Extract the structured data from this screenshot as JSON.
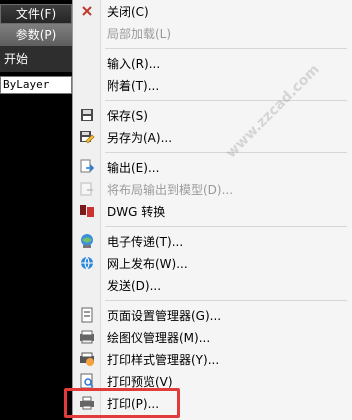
{
  "left": {
    "file_menu": "文件(F)",
    "params": "参数(P)",
    "start": "开始",
    "layer_combo": "ByLayer"
  },
  "menu": {
    "items": [
      {
        "label": "关闭(C)",
        "disabled": false,
        "icon": "close-x-icon"
      },
      {
        "label": "局部加载(L)",
        "disabled": true,
        "icon": ""
      },
      {
        "label": "输入(R)...",
        "disabled": false,
        "icon": ""
      },
      {
        "label": "附着(T)...",
        "disabled": false,
        "icon": ""
      },
      {
        "label": "保存(S)",
        "disabled": false,
        "icon": "save-icon"
      },
      {
        "label": "另存为(A)...",
        "disabled": false,
        "icon": "save-as-icon"
      },
      {
        "label": "输出(E)...",
        "disabled": false,
        "icon": "export-icon"
      },
      {
        "label": "将布局输出到模型(D)...",
        "disabled": true,
        "icon": ""
      },
      {
        "label": "DWG 转换",
        "disabled": false,
        "icon": "dwg-convert-icon"
      },
      {
        "label": "电子传递(T)...",
        "disabled": false,
        "icon": "etransmit-icon"
      },
      {
        "label": "网上发布(W)...",
        "disabled": false,
        "icon": "publish-web-icon"
      },
      {
        "label": "发送(D)...",
        "disabled": false,
        "icon": ""
      },
      {
        "label": "页面设置管理器(G)...",
        "disabled": false,
        "icon": "page-setup-icon"
      },
      {
        "label": "绘图仪管理器(M)...",
        "disabled": false,
        "icon": "plotter-manager-icon"
      },
      {
        "label": "打印样式管理器(Y)...",
        "disabled": false,
        "icon": "plot-style-icon"
      },
      {
        "label": "打印预览(V)",
        "disabled": false,
        "icon": "print-preview-icon"
      },
      {
        "label": "打印(P)...",
        "disabled": false,
        "icon": "print-icon"
      }
    ]
  },
  "watermark": "www.zzcad.com",
  "highlight_color": "#e23b3b"
}
